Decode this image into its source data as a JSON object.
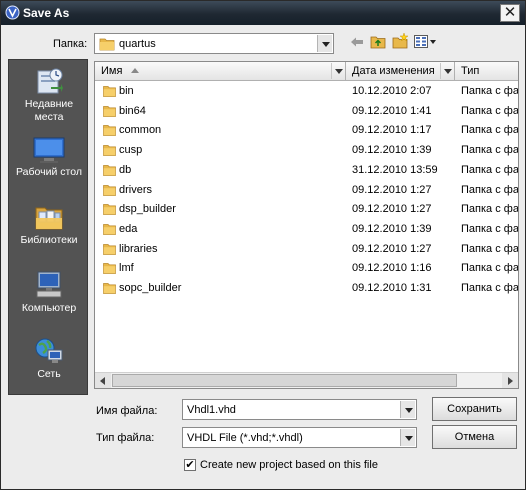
{
  "window": {
    "title": "Save As",
    "close_glyph": "✕"
  },
  "folder_bar": {
    "label": "Папка:",
    "current_folder": "quartus"
  },
  "toolbar": {
    "back": "back-arrow-icon",
    "up": "up-folder-icon",
    "new_folder": "new-folder-icon",
    "view_menu": "view-menu-icon"
  },
  "places": [
    {
      "label": "Недавние места",
      "icon": "recent-places-icon"
    },
    {
      "label": "Рабочий стол",
      "icon": "desktop-icon"
    },
    {
      "label": "Библиотеки",
      "icon": "libraries-icon"
    },
    {
      "label": "Компьютер",
      "icon": "computer-icon"
    },
    {
      "label": "Сеть",
      "icon": "network-icon"
    }
  ],
  "columns": {
    "name": "Имя",
    "date": "Дата изменения",
    "type": "Тип"
  },
  "files": [
    {
      "name": "bin",
      "date": "10.12.2010 2:07",
      "type": "Папка с фа"
    },
    {
      "name": "bin64",
      "date": "09.12.2010 1:41",
      "type": "Папка с фа"
    },
    {
      "name": "common",
      "date": "09.12.2010 1:17",
      "type": "Папка с фа"
    },
    {
      "name": "cusp",
      "date": "09.12.2010 1:39",
      "type": "Папка с фа"
    },
    {
      "name": "db",
      "date": "31.12.2010 13:59",
      "type": "Папка с фа"
    },
    {
      "name": "drivers",
      "date": "09.12.2010 1:27",
      "type": "Папка с фа"
    },
    {
      "name": "dsp_builder",
      "date": "09.12.2010 1:27",
      "type": "Папка с фа"
    },
    {
      "name": "eda",
      "date": "09.12.2010 1:39",
      "type": "Папка с фа"
    },
    {
      "name": "libraries",
      "date": "09.12.2010 1:27",
      "type": "Папка с фа"
    },
    {
      "name": "lmf",
      "date": "09.12.2010 1:16",
      "type": "Папка с фа"
    },
    {
      "name": "sopc_builder",
      "date": "09.12.2010 1:31",
      "type": "Папка с фа"
    }
  ],
  "filename": {
    "label": "Имя файла:",
    "value": "Vhdl1.vhd"
  },
  "filetype": {
    "label": "Тип файла:",
    "value": "VHDL File (*.vhd;*.vhdl)"
  },
  "buttons": {
    "save": "Сохранить",
    "cancel": "Отмена"
  },
  "checkbox": {
    "label": "Create new project based on this file",
    "checked": true,
    "mark": "✔"
  },
  "colors": {
    "titlebar": "#1f2832",
    "places_bg": "#535353",
    "folder": "#e8b84a"
  }
}
